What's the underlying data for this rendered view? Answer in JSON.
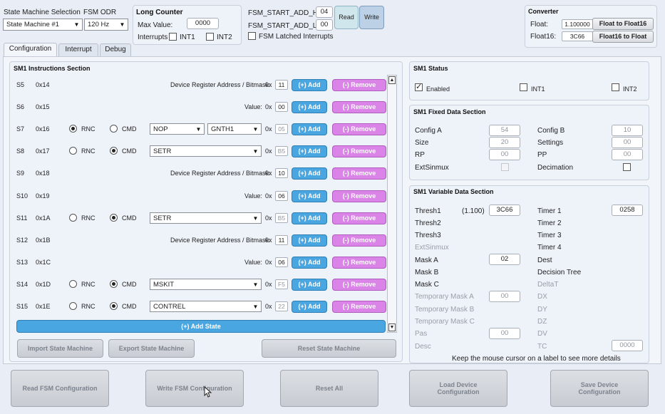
{
  "header": {
    "sm_selection_label": "State Machine Selection",
    "sm_selection_value": "State Machine #1",
    "fsm_odr_label": "FSM ODR",
    "fsm_odr_value": "120 Hz",
    "long_counter": {
      "title": "Long Counter",
      "max_value_label": "Max Value:",
      "max_value": "0000",
      "interrupts_label": "Interrupts",
      "int1_label": "INT1",
      "int2_label": "INT2"
    },
    "fsm_start_add_h_label": "FSM_START_ADD_H:",
    "fsm_start_add_h_value": "04",
    "fsm_start_add_l_label": "FSM_START_ADD_L:",
    "fsm_start_add_l_value": "00",
    "fsm_latched_label": "FSM Latched Interrupts",
    "read_label": "Read",
    "write_label": "Write",
    "converter": {
      "title": "Converter",
      "float_label": "Float:",
      "float_value": "1.100000",
      "float16_label": "Float16:",
      "float16_value": "3C66",
      "to_float16_label": "Float to Float16",
      "to_float_label": "Float16 to Float"
    }
  },
  "tabs": [
    "Configuration",
    "Interrupt",
    "Debug"
  ],
  "instructions": {
    "title": "SM1 Instructions Section",
    "reg_bitmask_label": "Device Register Address / Bitmask:",
    "value_label": "Value:",
    "hex_prefix": "0x",
    "rnc_label": "RNC",
    "cmd_label": "CMD",
    "add_label": "(+) Add",
    "remove_label": "(-) Remove",
    "rows": [
      {
        "state": "S5",
        "addr": "0x14",
        "kind": "reg",
        "value": "11"
      },
      {
        "state": "S6",
        "addr": "0x15",
        "kind": "val",
        "value": "00"
      },
      {
        "state": "S7",
        "addr": "0x16",
        "kind": "rnc",
        "sel1": "NOP",
        "sel2": "GNTH1",
        "value": "05"
      },
      {
        "state": "S8",
        "addr": "0x17",
        "kind": "cmd",
        "sel1": "SETR",
        "value": "B5"
      },
      {
        "state": "S9",
        "addr": "0x18",
        "kind": "reg",
        "value": "10"
      },
      {
        "state": "S10",
        "addr": "0x19",
        "kind": "val",
        "value": "06"
      },
      {
        "state": "S11",
        "addr": "0x1A",
        "kind": "cmd",
        "sel1": "SETR",
        "value": "B5"
      },
      {
        "state": "S12",
        "addr": "0x1B",
        "kind": "reg",
        "value": "11"
      },
      {
        "state": "S13",
        "addr": "0x1C",
        "kind": "val",
        "value": "06"
      },
      {
        "state": "S14",
        "addr": "0x1D",
        "kind": "cmd",
        "sel1": "MSKIT",
        "value": "F5"
      },
      {
        "state": "S15",
        "addr": "0x1E",
        "kind": "cmd",
        "sel1": "CONTREL",
        "value": "22"
      }
    ],
    "add_state_label": "(+) Add State",
    "import_label": "Import State Machine",
    "export_label": "Export State Machine",
    "reset_label": "Reset State Machine"
  },
  "status": {
    "title": "SM1 Status",
    "enabled_label": "Enabled",
    "int1_label": "INT1",
    "int2_label": "INT2"
  },
  "fixed": {
    "title": "SM1 Fixed Data Section",
    "config_a_label": "Config A",
    "config_a": "54",
    "config_b_label": "Config B",
    "config_b": "10",
    "size_label": "Size",
    "size": "20",
    "settings_label": "Settings",
    "settings": "00",
    "rp_label": "RP",
    "rp": "00",
    "pp_label": "PP",
    "pp": "00",
    "extsinmux_label": "ExtSinmux",
    "decimation_label": "Decimation"
  },
  "variable": {
    "title": "SM1 Variable Data Section",
    "thresh1_label": "Thresh1",
    "thresh1_float": "(1.100)",
    "thresh1": "3C66",
    "thresh2_label": "Thresh2",
    "thresh3_label": "Thresh3",
    "extsinmux_label": "ExtSinmux",
    "mask_a_label": "Mask A",
    "mask_a": "02",
    "mask_b_label": "Mask B",
    "mask_c_label": "Mask C",
    "tmask_a_label": "Temporary Mask A",
    "tmask_a": "00",
    "tmask_b_label": "Temporary Mask B",
    "tmask_c_label": "Temporary Mask C",
    "pas_label": "Pas",
    "pas": "00",
    "desc_label": "Desc",
    "timer1_label": "Timer 1",
    "timer1": "0258",
    "timer2_label": "Timer 2",
    "timer3_label": "Timer 3",
    "timer4_label": "Timer 4",
    "dest_label": "Dest",
    "decision_tree_label": "Decision Tree",
    "deltat_label": "DeltaT",
    "dx_label": "DX",
    "dy_label": "DY",
    "dz_label": "DZ",
    "dv_label": "DV",
    "tc_label": "TC",
    "tc": "0000",
    "hint": "Keep the mouse cursor on a label to see more details"
  },
  "footer": {
    "read_fsm": "Read FSM Configuration",
    "write_fsm": "Write FSM Configuration",
    "reset_all": "Reset All",
    "load_device": "Load Device Configuration",
    "save_device": "Save Device Configuration"
  }
}
